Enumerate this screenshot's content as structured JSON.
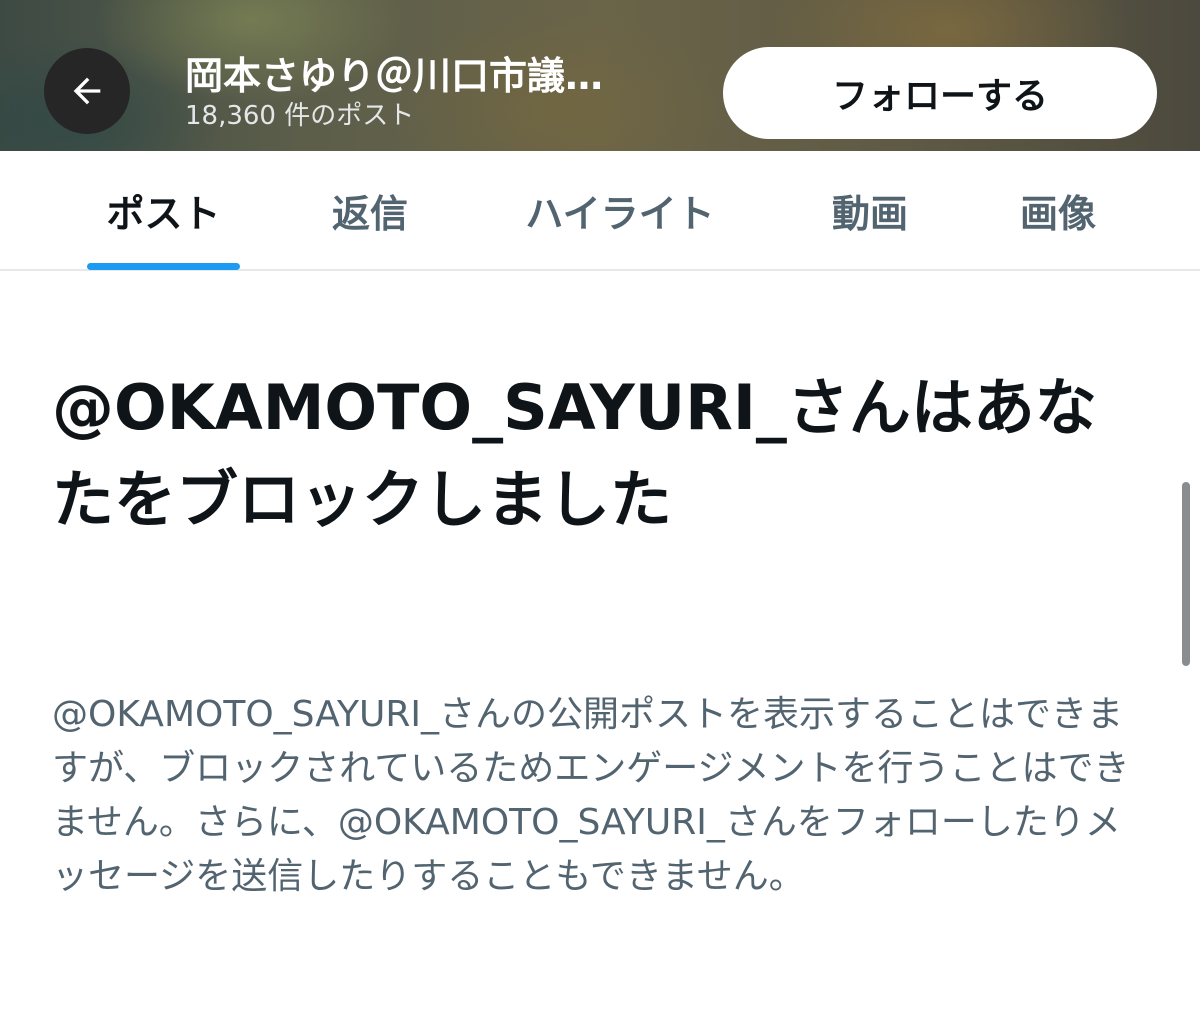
{
  "header": {
    "profile_name": "岡本さゆり＠川口市議…",
    "post_count": "18,360 件のポスト",
    "follow_label": "フォローする",
    "back_icon": "arrow-left-icon"
  },
  "tabs": [
    {
      "label": "ポスト",
      "active": true
    },
    {
      "label": "返信",
      "active": false
    },
    {
      "label": "ハイライト",
      "active": false
    },
    {
      "label": "動画",
      "active": false
    },
    {
      "label": "画像",
      "active": false
    }
  ],
  "blocked": {
    "headline": "@OKAMOTO_SAYURI_さんはあなたをブロックしました",
    "description": "@OKAMOTO_SAYURI_さんの公開ポストを表示することはできますが、ブロックされているためエンゲージメントを行うことはできません。さらに、@OKAMOTO_SAYURI_さんをフォローしたりメッセージを送信したりすることもできません。"
  },
  "colors": {
    "accent": "#1d9bf0",
    "text_primary": "#0f1419",
    "text_secondary": "#536471"
  }
}
